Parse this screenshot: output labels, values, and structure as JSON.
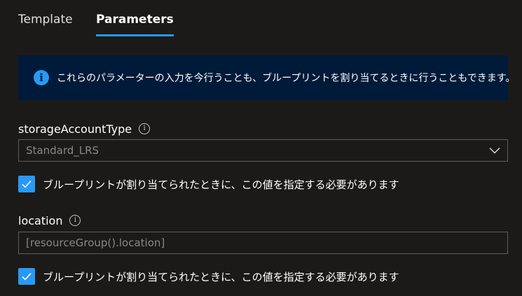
{
  "tabs": [
    {
      "label": "Template",
      "active": false
    },
    {
      "label": "Parameters",
      "active": true
    }
  ],
  "banner": {
    "icon": "info-icon",
    "text": "これらのパラメーターの入力を今行うことも、ブループリントを割り当てるときに行うこともできます。"
  },
  "fields": {
    "storage": {
      "label": "storageAccountType",
      "help_icon": "info-circle-icon",
      "selected_value": "Standard_LRS",
      "checkbox_label": "ブループリントが割り当てられたときに、この値を指定する必要があります",
      "checked": true
    },
    "location": {
      "label": "location",
      "help_icon": "info-circle-icon",
      "placeholder": "[resourceGroup().location]",
      "checkbox_label": "ブループリントが割り当てられたときに、この値を指定する必要があります",
      "checked": true
    }
  },
  "colors": {
    "accent": "#2899f5",
    "banner_bg": "#001a39",
    "page_bg": "#1b1a19"
  }
}
